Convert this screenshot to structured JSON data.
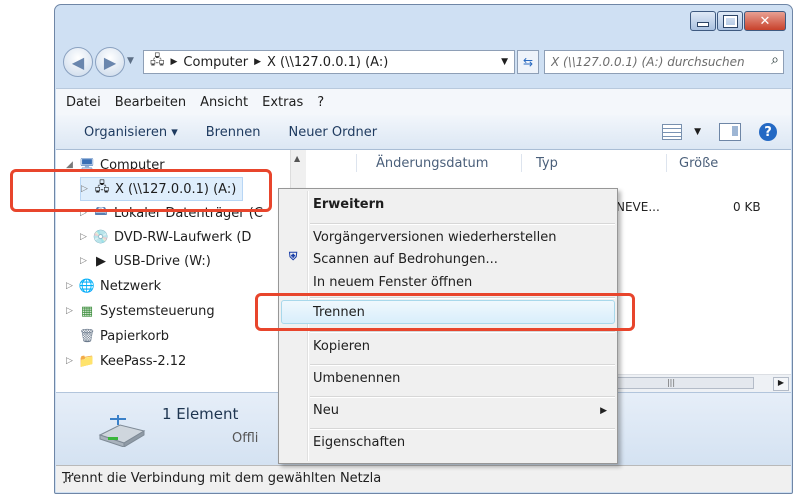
{
  "address": {
    "crumbs": [
      "Computer",
      "X (\\\\127.0.0.1) (A:)"
    ],
    "search_placeholder": "X (\\\\127.0.0.1) (A:) durchsuchen"
  },
  "menubar": [
    "Datei",
    "Bearbeiten",
    "Ansicht",
    "Extras",
    "?"
  ],
  "toolbar": {
    "organize": "Organisieren ▾",
    "burn": "Brennen",
    "new_folder": "Neuer Ordner"
  },
  "tree": [
    {
      "label": "Computer",
      "icon": "computer-icon",
      "expanded": true
    },
    {
      "label": "X (\\\\127.0.0.1) (A:)",
      "icon": "network-drive-icon",
      "selected": true
    },
    {
      "label": "Lokaler Datenträger (C",
      "icon": "local-disk-icon"
    },
    {
      "label": "DVD-RW-Laufwerk (D",
      "icon": "dvd-drive-icon"
    },
    {
      "label": "USB-Drive (W:)",
      "icon": "usb-drive-icon"
    },
    {
      "label": "Netzwerk",
      "icon": "network-icon"
    },
    {
      "label": "Systemsteuerung",
      "icon": "control-panel-icon"
    },
    {
      "label": "Papierkorb",
      "icon": "recycle-bin-icon"
    },
    {
      "label": "KeePass-2.12",
      "icon": "folder-icon"
    }
  ],
  "columns": [
    "Änderungsdatum",
    "Typ",
    "Größe"
  ],
  "file_row": {
    "type": "NEVE...",
    "size": "0 KB"
  },
  "details": {
    "count": "1 Element",
    "offline": "Offli"
  },
  "status": "Trennt die Verbindung mit dem gewählten Netzla",
  "context_menu": {
    "expand": "Erweitern",
    "restore": "Vorgängerversionen wiederherstellen",
    "scan": "Scannen auf Bedrohungen...",
    "new_window": "In neuem Fenster öffnen",
    "disconnect": "Trennen",
    "copy": "Kopieren",
    "rename": "Umbenennen",
    "new": "Neu",
    "properties": "Eigenschaften"
  },
  "colors": {
    "highlight": "#e8452c",
    "accent": "#2469c4"
  }
}
